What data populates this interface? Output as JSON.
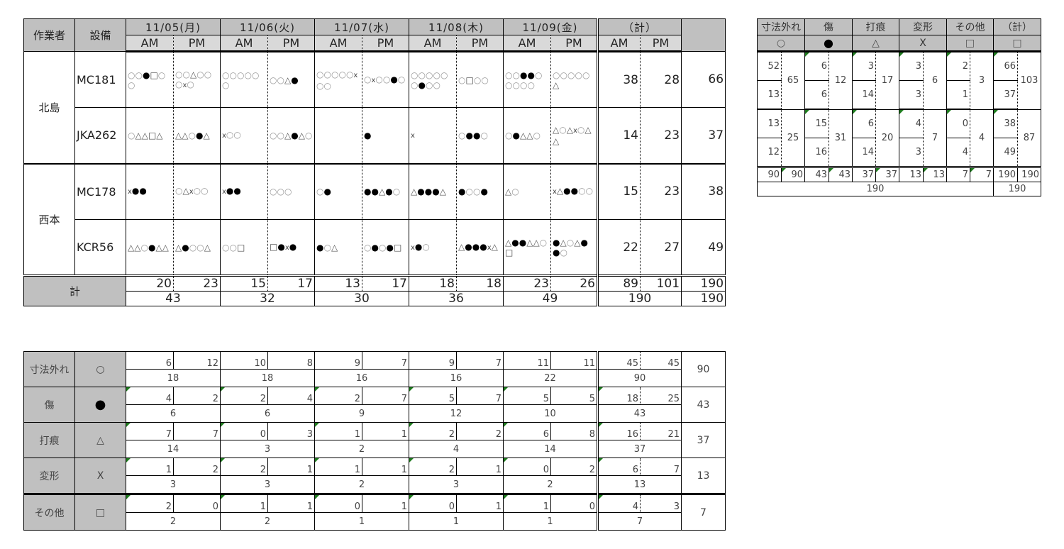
{
  "main": {
    "headers": {
      "worker": "作業者",
      "equipment": "設備",
      "total": "（計）",
      "am": "AM",
      "pm": "PM",
      "am_total": "AM",
      "pm_total": "PM"
    },
    "dates": [
      "11/05(月)",
      "11/06(火)",
      "11/07(水)",
      "11/08(木)",
      "11/09(金)"
    ],
    "workers": [
      {
        "name": "北島",
        "rows": [
          {
            "equipment": "MC181",
            "cells": [
              "○○●□○○",
              "○○△○○○x○",
              "○○○○○○",
              "○○△●",
              "○○○○○x○○",
              "○x○○●○",
              "○○○○○○●○○",
              "○□○○",
              "○○●●○○○○○",
              "○○○○○△"
            ],
            "am": "38",
            "pm": "28",
            "total": "66"
          },
          {
            "equipment": "JKA262",
            "cells": [
              "○△△□△",
              "△△○●△",
              "x○○",
              "○○△●△○",
              "",
              "●",
              "x",
              "○●●○",
              "○●△△○",
              "△○△x○△△"
            ],
            "am": "14",
            "pm": "23",
            "total": "37"
          }
        ]
      },
      {
        "name": "西本",
        "rows": [
          {
            "equipment": "MC178",
            "cells": [
              "x●●",
              "○△x○○",
              "x●●",
              "○○○",
              "○●",
              "●●△●○",
              "△●●●△",
              "●○○●",
              "△○",
              "x△●●○○"
            ],
            "am": "15",
            "pm": "23",
            "total": "38"
          },
          {
            "equipment": "KCR56",
            "cells": [
              "△△○●△△",
              "△●○○△",
              "○○□",
              "□●x●",
              "●○△",
              "○●○●□",
              "x●○",
              "△●●●x△",
              "△●●△△○□",
              "●△○△●●○"
            ],
            "am": "22",
            "pm": "27",
            "total": "49"
          }
        ]
      }
    ],
    "totals": {
      "label": "計",
      "halfday": [
        "20",
        "23",
        "15",
        "17",
        "13",
        "17",
        "18",
        "18",
        "23",
        "26"
      ],
      "daily": [
        "43",
        "32",
        "30",
        "36",
        "49"
      ],
      "am": "89",
      "pm": "101",
      "grand_row1": "190",
      "sum_ampm": "190",
      "grand_row2": "190"
    }
  },
  "right": {
    "categories": [
      {
        "name": "寸法外れ",
        "symbol": "○"
      },
      {
        "name": "傷",
        "symbol": "●"
      },
      {
        "name": "打痕",
        "symbol": "△"
      },
      {
        "name": "変形",
        "symbol": "X"
      },
      {
        "name": "その他",
        "symbol": "□"
      },
      {
        "name": "（計）",
        "symbol": "□"
      }
    ],
    "groups": [
      {
        "top": [
          "52",
          "6",
          "3",
          "3",
          "2",
          "66"
        ],
        "bottom": [
          "13",
          "6",
          "14",
          "3",
          "1",
          "37"
        ],
        "sum": [
          "65",
          "12",
          "17",
          "6",
          "3",
          "103"
        ]
      },
      {
        "top": [
          "13",
          "15",
          "6",
          "4",
          "0",
          "38"
        ],
        "bottom": [
          "12",
          "16",
          "14",
          "3",
          "4",
          "49"
        ],
        "sum": [
          "25",
          "31",
          "20",
          "7",
          "4",
          "87"
        ]
      }
    ],
    "totals_row": [
      [
        "90",
        "90"
      ],
      [
        "43",
        "43"
      ],
      [
        "37",
        "37"
      ],
      [
        "13",
        "13"
      ],
      [
        "7",
        "7"
      ],
      [
        "190",
        "190"
      ]
    ],
    "grand": "190",
    "grand_total": "190"
  },
  "bottom": {
    "rows": [
      {
        "name": "寸法外れ",
        "symbol": "○",
        "pairs": [
          [
            "6",
            "12"
          ],
          [
            "10",
            "8"
          ],
          [
            "9",
            "7"
          ],
          [
            "9",
            "7"
          ],
          [
            "11",
            "11"
          ]
        ],
        "daily": [
          "18",
          "18",
          "16",
          "16",
          "22"
        ],
        "ampm": [
          "45",
          "45"
        ],
        "sum": "90",
        "grand": "90"
      },
      {
        "name": "傷",
        "symbol": "●",
        "pairs": [
          [
            "4",
            "2"
          ],
          [
            "2",
            "4"
          ],
          [
            "2",
            "7"
          ],
          [
            "5",
            "7"
          ],
          [
            "5",
            "5"
          ]
        ],
        "daily": [
          "6",
          "6",
          "9",
          "12",
          "10"
        ],
        "ampm": [
          "18",
          "25"
        ],
        "sum": "43",
        "grand": "43"
      },
      {
        "name": "打痕",
        "symbol": "△",
        "pairs": [
          [
            "7",
            "7"
          ],
          [
            "0",
            "3"
          ],
          [
            "1",
            "1"
          ],
          [
            "2",
            "2"
          ],
          [
            "6",
            "8"
          ]
        ],
        "daily": [
          "14",
          "3",
          "2",
          "4",
          "14"
        ],
        "ampm": [
          "16",
          "21"
        ],
        "sum": "37",
        "grand": "37"
      },
      {
        "name": "変形",
        "symbol": "X",
        "pairs": [
          [
            "1",
            "2"
          ],
          [
            "2",
            "1"
          ],
          [
            "1",
            "1"
          ],
          [
            "2",
            "1"
          ],
          [
            "0",
            "2"
          ]
        ],
        "daily": [
          "3",
          "3",
          "2",
          "3",
          "2"
        ],
        "ampm": [
          "6",
          "7"
        ],
        "sum": "13",
        "grand": "13"
      },
      {
        "name": "その他",
        "symbol": "□",
        "pairs": [
          [
            "2",
            "0"
          ],
          [
            "1",
            "1"
          ],
          [
            "0",
            "1"
          ],
          [
            "0",
            "1"
          ],
          [
            "1",
            "0"
          ]
        ],
        "daily": [
          "2",
          "2",
          "1",
          "1",
          "1"
        ],
        "ampm": [
          "4",
          "3"
        ],
        "sum": "7",
        "grand": "7"
      }
    ]
  }
}
